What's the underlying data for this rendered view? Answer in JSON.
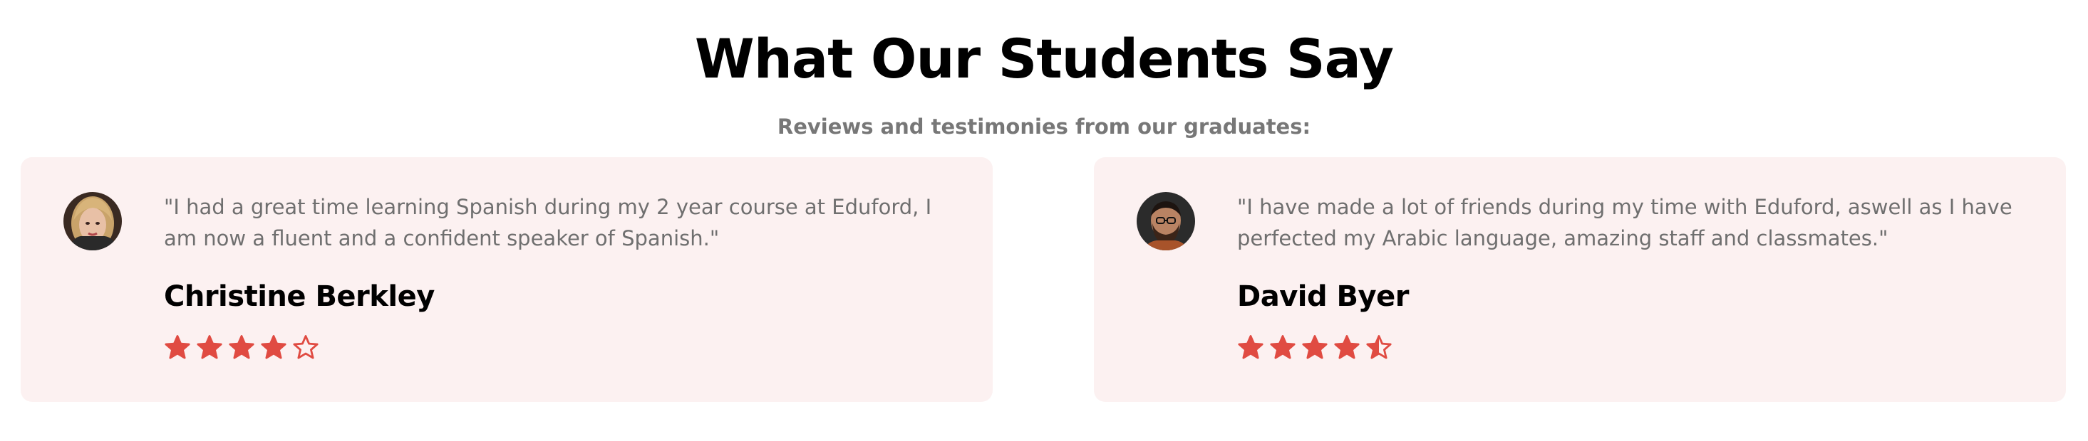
{
  "section": {
    "title": "What Our Students Say",
    "subtitle": "Reviews and testimonies from our graduates:"
  },
  "accent_color": "#e04b42",
  "card_background": "#fcf1f1",
  "testimonials": [
    {
      "quote": "\"I had a great time learning Spanish during my 2 year course at Eduford, I am now a fluent and a confident speaker of Spanish.\"",
      "name": "Christine Berkley",
      "rating": 4,
      "max_rating": 5,
      "avatar_icon": "avatar-photo-woman"
    },
    {
      "quote": "\"I have made a lot of friends during my time with Eduford, aswell as I have perfected my Arabic language, amazing staff and classmates.\"",
      "name": "David Byer",
      "rating": 4.5,
      "max_rating": 5,
      "avatar_icon": "avatar-photo-man"
    }
  ]
}
